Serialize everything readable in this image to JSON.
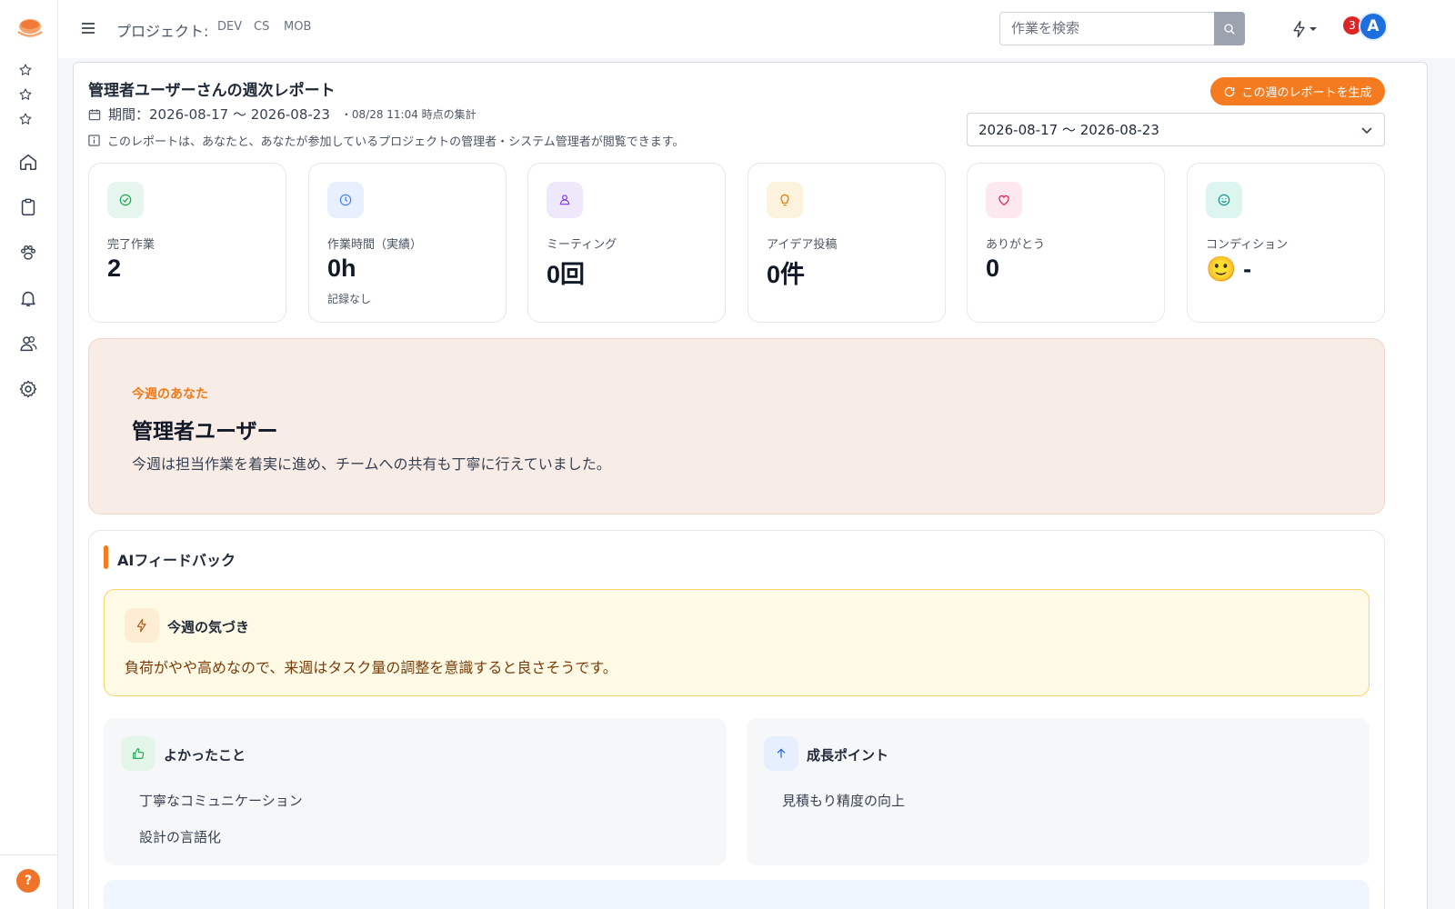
{
  "header": {
    "project_label": "プロジェクト:",
    "projects": [
      "DEV",
      "CS",
      "MOB"
    ],
    "search_placeholder": "作業を検索",
    "notification_count": "3",
    "avatar_initial": "A"
  },
  "report": {
    "title": "管理者ユーザーさんの週次レポート",
    "period_text": "期間：2026-08-17 〜 2026-08-23",
    "period_meta": "・08/28 11:04 時点の集計",
    "notice": "このレポートは、あなたと、あなたが参加しているプロジェクトの管理者・システム管理者が閲覧できます。",
    "generate_button": "この週のレポートを生成",
    "selected_period": "2026-08-17 〜 2026-08-23"
  },
  "stats": [
    {
      "label": "完了作業",
      "value": "2",
      "sub": "",
      "icon": "check-circle-icon",
      "icon_bg": "#e6f6ee",
      "icon_color": "#16a34a"
    },
    {
      "label": "作業時間（実績）",
      "value": "0h",
      "sub": "記録なし",
      "icon": "clock-icon",
      "icon_bg": "#e8f0fd",
      "icon_color": "#3b82f6"
    },
    {
      "label": "ミーティング",
      "value": "0回",
      "sub": "",
      "icon": "people-icon",
      "icon_bg": "#efe8fb",
      "icon_color": "#7c3aed"
    },
    {
      "label": "アイデア投稿",
      "value": "0件",
      "sub": "",
      "icon": "lightbulb-icon",
      "icon_bg": "#fdf2dc",
      "icon_color": "#d97706"
    },
    {
      "label": "ありがとう",
      "value": "0",
      "sub": "",
      "icon": "heart-icon",
      "icon_bg": "#fde8ef",
      "icon_color": "#e11d48"
    },
    {
      "label": "コンディション",
      "value": "🙂 -",
      "sub": "",
      "icon": "smile-icon",
      "icon_bg": "#dcf5ef",
      "icon_color": "#0d9488"
    }
  ],
  "hero": {
    "eyebrow": "今週のあなた",
    "name": "管理者ユーザー",
    "summary": "今週は担当作業を着実に進め、チームへの共有も丁寧に行えていました。"
  },
  "ai_feedback": {
    "title": "AIフィードバック",
    "insight_title": "今週の気づき",
    "insight_text": "負荷がやや高めなので、来週はタスク量の調整を意識すると良さそうです。",
    "good_title": "よかったこと",
    "good_items": [
      "丁寧なコミュニケーション",
      "設計の言語化"
    ],
    "growth_title": "成長ポイント",
    "growth_items": [
      "見積もり精度の向上"
    ]
  },
  "colors": {
    "accent": "#f47b20",
    "notification": "#dc2626",
    "avatar": "#1d6fe0"
  }
}
